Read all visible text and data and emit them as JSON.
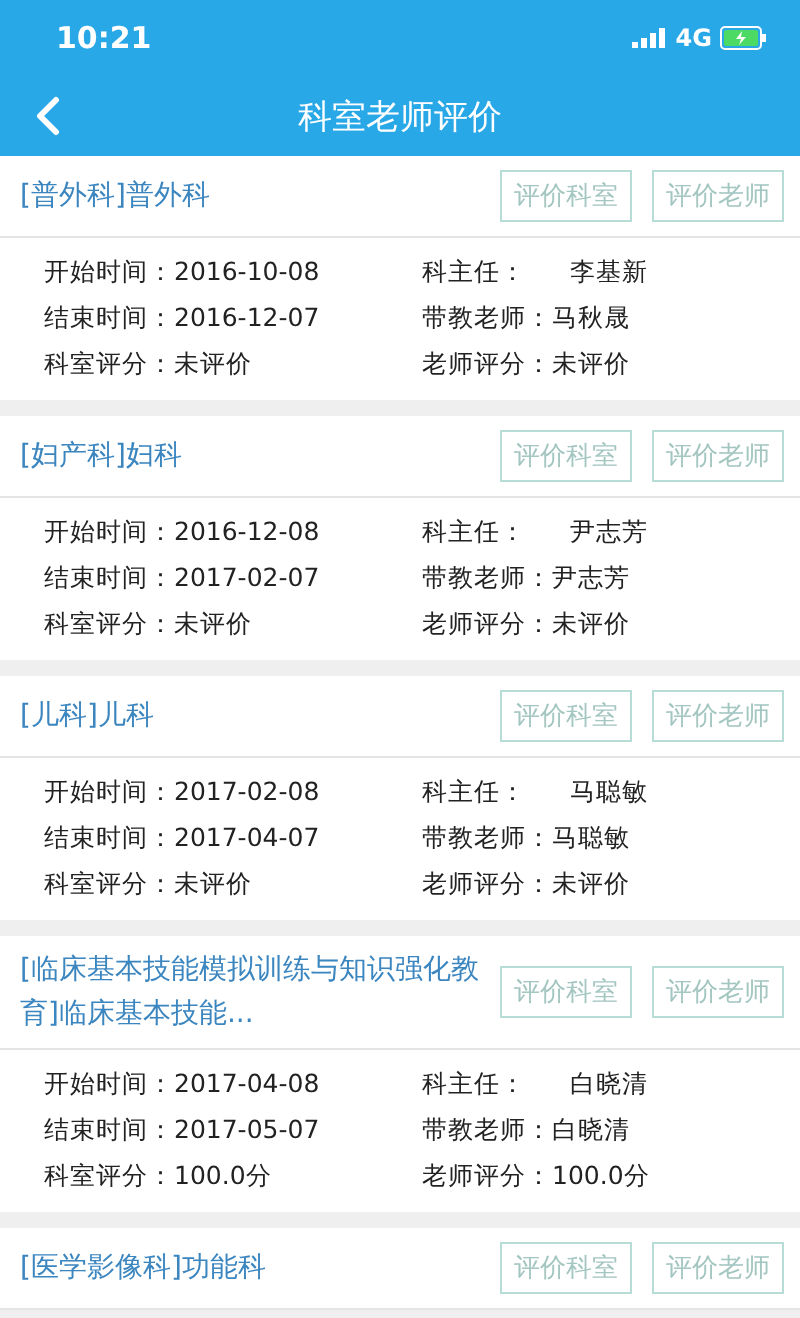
{
  "status_bar": {
    "time": "10:21",
    "network": "4G"
  },
  "nav": {
    "title": "科室老师评价"
  },
  "courses": [
    {
      "title": "[普外科]普外科",
      "buttons": [
        {
          "label": "评价科室",
          "disabled": true
        },
        {
          "label": "评价老师",
          "disabled": true
        }
      ],
      "start": {
        "label": "开始时间：",
        "value": "2016-10-08"
      },
      "end": {
        "label": "结束时间：",
        "value": "2016-12-07"
      },
      "dept_score": {
        "label": "科室评分：",
        "value": "未评价"
      },
      "director": {
        "label": "科主任：",
        "value": "李基新"
      },
      "teacher": {
        "label": "带教老师：",
        "value": "马秋晟"
      },
      "teacher_score": {
        "label": "老师评分：",
        "value": "未评价"
      }
    },
    {
      "title": "[妇产科]妇科",
      "buttons": [
        {
          "label": "评价科室",
          "disabled": true
        },
        {
          "label": "评价老师",
          "disabled": true
        }
      ],
      "start": {
        "label": "开始时间：",
        "value": "2016-12-08"
      },
      "end": {
        "label": "结束时间：",
        "value": "2017-02-07"
      },
      "dept_score": {
        "label": "科室评分：",
        "value": "未评价"
      },
      "director": {
        "label": "科主任：",
        "value": "尹志芳"
      },
      "teacher": {
        "label": "带教老师：",
        "value": "尹志芳"
      },
      "teacher_score": {
        "label": "老师评分：",
        "value": "未评价"
      }
    },
    {
      "title": "[儿科]儿科",
      "buttons": [
        {
          "label": "评价科室",
          "disabled": true
        },
        {
          "label": "评价老师",
          "disabled": true
        }
      ],
      "start": {
        "label": "开始时间：",
        "value": "2017-02-08"
      },
      "end": {
        "label": "结束时间：",
        "value": "2017-04-07"
      },
      "dept_score": {
        "label": "科室评分：",
        "value": "未评价"
      },
      "director": {
        "label": "科主任：",
        "value": "马聪敏"
      },
      "teacher": {
        "label": "带教老师：",
        "value": "马聪敏"
      },
      "teacher_score": {
        "label": "老师评分：",
        "value": "未评价"
      }
    },
    {
      "title": "[临床基本技能模拟训练与知识强化教育]临床基本技能...",
      "buttons": [
        {
          "label": "评价科室",
          "disabled": true
        },
        {
          "label": "评价老师",
          "disabled": true
        }
      ],
      "start": {
        "label": "开始时间：",
        "value": "2017-04-08"
      },
      "end": {
        "label": "结束时间：",
        "value": "2017-05-07"
      },
      "dept_score": {
        "label": "科室评分：",
        "value": "100.0分"
      },
      "director": {
        "label": "科主任：",
        "value": "白晓清"
      },
      "teacher": {
        "label": "带教老师：",
        "value": "白晓清"
      },
      "teacher_score": {
        "label": "老师评分：",
        "value": "100.0分"
      }
    },
    {
      "title": "[医学影像科]功能科",
      "buttons": [
        {
          "label": "评价科室",
          "disabled": true
        },
        {
          "label": "评价老师",
          "disabled": true
        }
      ]
    }
  ]
}
